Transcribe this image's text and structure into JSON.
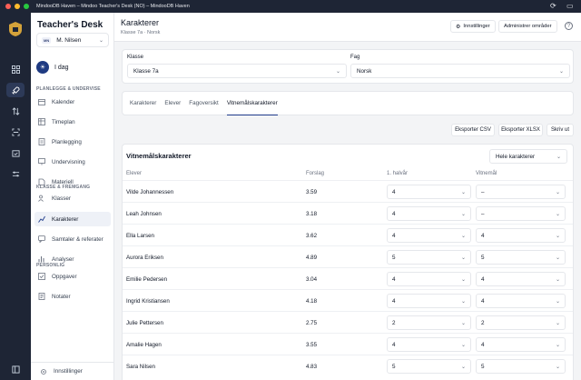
{
  "window": {
    "title": "MindooDB Haven – Mindoo Teacher's Desk (NO) – MindooDB Haven"
  },
  "app": {
    "brand": "Teacher's Desk",
    "user_initials": "MN",
    "user_name": "M. Nilsen",
    "today_label": "I dag"
  },
  "sidebar": {
    "section1": "PLANLEGGE & UNDERVISE",
    "section2": "KLASSE & FREMGANG",
    "section3": "PERSONLIG",
    "items": [
      {
        "label": "Kalender",
        "icon": "calendar-icon"
      },
      {
        "label": "Timeplan",
        "icon": "schedule-icon"
      },
      {
        "label": "Planlegging",
        "icon": "planning-icon"
      },
      {
        "label": "Undervisning",
        "icon": "teaching-icon"
      },
      {
        "label": "Materiell",
        "icon": "material-icon"
      },
      {
        "label": "Klasser",
        "icon": "classes-icon"
      },
      {
        "label": "Karakterer",
        "icon": "grades-icon",
        "active": true
      },
      {
        "label": "Samtaler & referater",
        "icon": "conversations-icon"
      },
      {
        "label": "Analyser",
        "icon": "analytics-icon"
      },
      {
        "label": "Oppgaver",
        "icon": "tasks-icon"
      },
      {
        "label": "Notater",
        "icon": "notes-icon"
      }
    ],
    "settings_label": "Innstillinger"
  },
  "header": {
    "title": "Karakterer",
    "subtitle": "Klasse 7a · Norsk",
    "settings_btn": "Innstillinger",
    "manage_btn": "Administrer områder",
    "help": "?"
  },
  "filters": {
    "class_label": "Klasse",
    "class_value": "Klasse 7a",
    "subject_label": "Fag",
    "subject_value": "Norsk"
  },
  "tabs": [
    "Karakterer",
    "Elever",
    "Fagoversikt",
    "Vitnemålskarakterer"
  ],
  "actions": {
    "csv": "Eksporter CSV",
    "xlsx": "Eksporter XLSX",
    "print": "Skriv ut"
  },
  "table": {
    "title": "Vitnemålskarakterer",
    "filter_value": "Hele karakterer",
    "headers": [
      "Elever",
      "Forslag",
      "1. halvår",
      "Vitnemål"
    ],
    "rows": [
      {
        "name": "Vilde Johannessen",
        "forslag": "3.59",
        "halvar": "4",
        "vitnemal": "–"
      },
      {
        "name": "Leah Johnsen",
        "forslag": "3.18",
        "halvar": "4",
        "vitnemal": "–"
      },
      {
        "name": "Ella Larsen",
        "forslag": "3.62",
        "halvar": "4",
        "vitnemal": "4"
      },
      {
        "name": "Aurora Eriksen",
        "forslag": "4.89",
        "halvar": "5",
        "vitnemal": "5"
      },
      {
        "name": "Emilie Pedersen",
        "forslag": "3.04",
        "halvar": "4",
        "vitnemal": "4"
      },
      {
        "name": "Ingrid Kristiansen",
        "forslag": "4.18",
        "halvar": "4",
        "vitnemal": "4"
      },
      {
        "name": "Julie Pettersen",
        "forslag": "2.75",
        "halvar": "2",
        "vitnemal": "2"
      },
      {
        "name": "Amalie Hagen",
        "forslag": "3.55",
        "halvar": "4",
        "vitnemal": "4"
      },
      {
        "name": "Sara Nilsen",
        "forslag": "4.83",
        "halvar": "5",
        "vitnemal": "5"
      }
    ]
  },
  "colors": {
    "rail": "#1e2535",
    "accent": "#1e3a8a"
  }
}
